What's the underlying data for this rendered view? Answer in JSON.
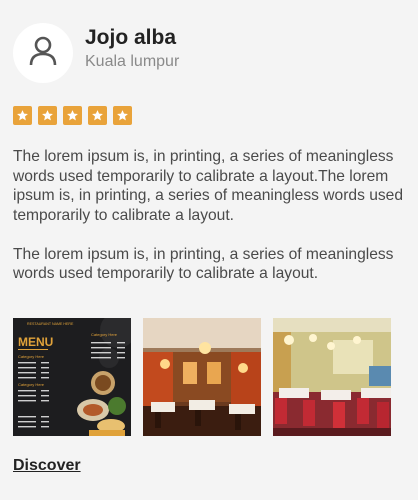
{
  "review": {
    "author": {
      "name": "Jojo alba",
      "location": "Kuala lumpur",
      "avatar_icon": "user-icon"
    },
    "rating": {
      "value": 5,
      "max": 5,
      "star_color": "#e9a33a"
    },
    "paragraphs": [
      "The lorem ipsum is, in printing, a series of meaningless words used temporarily to calibrate a layout.The lorem ipsum is, in printing, a series of meaningless words used temporarily to calibrate a layout.",
      "The lorem ipsum is, in printing, a series of meaningless words used temporarily to calibrate a layout."
    ],
    "photos": [
      {
        "image": "restaurant-menu-flyer",
        "texts": [
          "RESTAURANT NAME HERE",
          "MENU",
          "Category Here",
          "Category Here",
          "Category Here"
        ]
      },
      {
        "image": "restaurant-dining-room-warm-lights"
      },
      {
        "image": "restaurant-dining-room-red-chairs"
      }
    ],
    "discover_label": "Discover"
  }
}
